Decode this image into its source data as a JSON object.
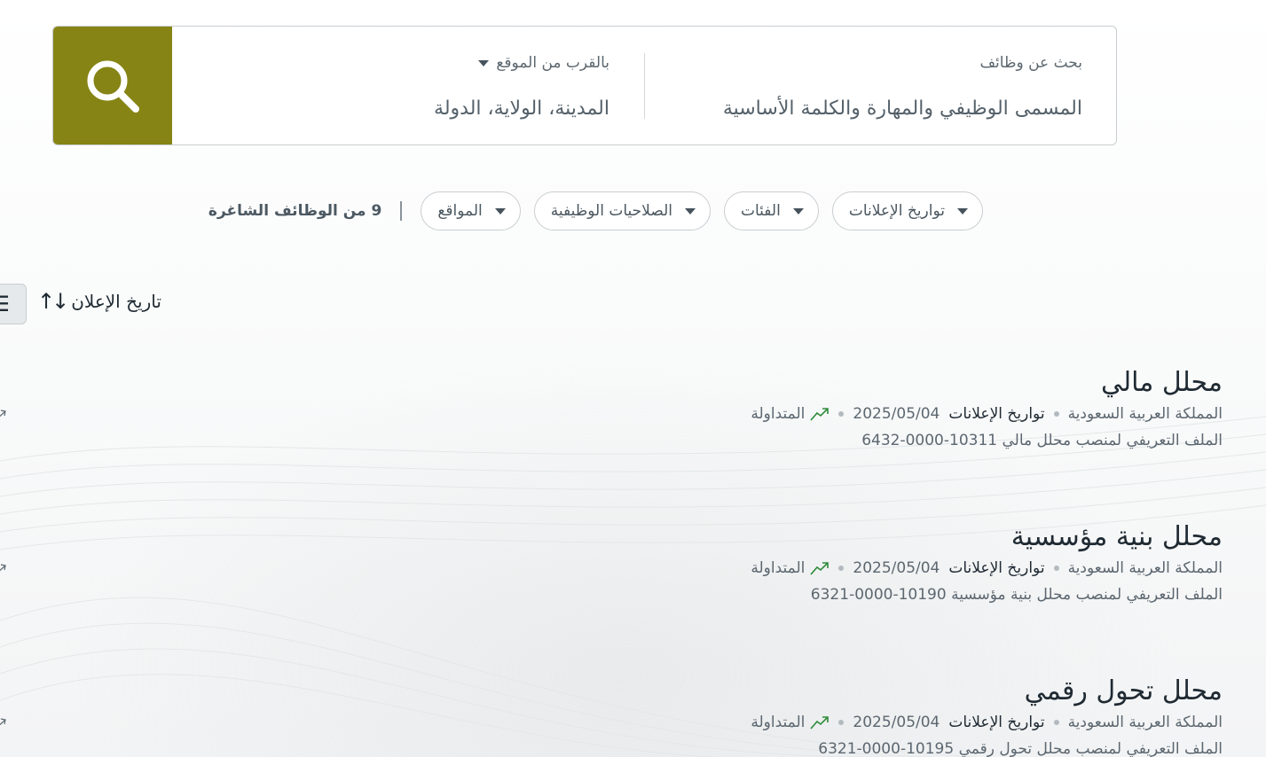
{
  "search": {
    "keyword_label": "بحث عن وظائف",
    "keyword_placeholder": "المسمى الوظيفي والمهارة والكلمة الأساسية",
    "location_label": "بالقرب من الموقع",
    "location_placeholder": "المدينة، الولاية، الدولة"
  },
  "filters": {
    "result_count": "9 من الوظائف الشاغرة",
    "items": [
      {
        "label": "المواقع"
      },
      {
        "label": "الصلاحيات الوظيفية"
      },
      {
        "label": "الفئات"
      },
      {
        "label": "تواريخ الإعلانات"
      }
    ]
  },
  "sort": {
    "label": "تاريخ الإعلان",
    "arrows": "↑↓"
  },
  "view_toggle": {
    "icon": "list-icon",
    "glyph": "☰"
  },
  "jobs": [
    {
      "title": "محلل مالي",
      "location": "المملكة العربية السعودية",
      "date_label": "تواريخ الإعلانات",
      "date": "2025/05/04",
      "trend_label": "المتداولة",
      "description": "الملف التعريفي لمنصب محلل مالي 10311-0000-6432"
    },
    {
      "title": "محلل بنية مؤسسية",
      "location": "المملكة العربية السعودية",
      "date_label": "تواريخ الإعلانات",
      "date": "2025/05/04",
      "trend_label": "المتداولة",
      "description": "الملف التعريفي لمنصب محلل بنية مؤسسية 10190-0000-6321"
    },
    {
      "title": "محلل تحول رقمي",
      "location": "المملكة العربية السعودية",
      "date_label": "تواريخ الإعلانات",
      "date": "2025/05/04",
      "trend_label": "المتداولة",
      "description": "الملف التعريفي لمنصب محلل تحول رقمي 10195-0000-6321"
    }
  ],
  "colors": {
    "search_button": "#868415",
    "trend_icon": "#2e8b3a",
    "title_text": "#1f2a33",
    "muted_text": "#5c6770"
  }
}
